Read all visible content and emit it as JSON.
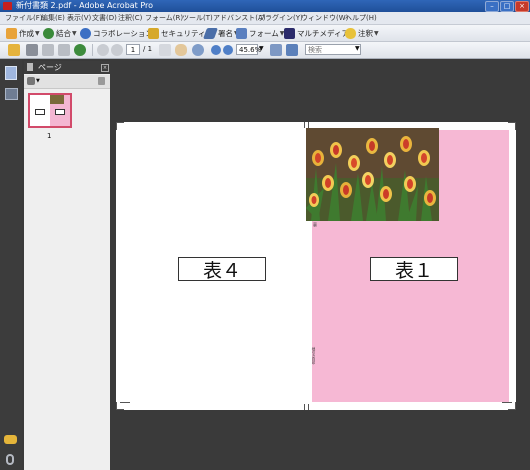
{
  "window": {
    "title": "新付書類 2.pdf - Adobe Acrobat Pro"
  },
  "menu": [
    "ファイル(F)",
    "編集(E)",
    "表示(V)",
    "文書(D)",
    "注釈(C)",
    "フォーム(R)",
    "ツール(T)",
    "アドバンスト(A)",
    "プラグイン(Y)",
    "ウィンドウ(W)",
    "ヘルプ(H)"
  ],
  "toolbar1": {
    "create": "作成",
    "combine": "結合",
    "collaborate": "コラボレーション",
    "secure": "セキュリティ",
    "sign": "署名",
    "forms": "フォーム",
    "multimedia": "マルチメディア",
    "comment": "注釈"
  },
  "toolbar2": {
    "page_current": "1",
    "page_total": "/ 1",
    "zoom": "45.6%",
    "search_placeholder": "検索"
  },
  "panel": {
    "title": "ページ",
    "thumb_label": "1"
  },
  "document": {
    "left_label": "表４",
    "right_label": "表１",
    "small_mark": "裏",
    "vertical_note": "地引き目印"
  },
  "colors": {
    "pink": "#f6b8d4",
    "titlebar": "#2f66b8"
  }
}
